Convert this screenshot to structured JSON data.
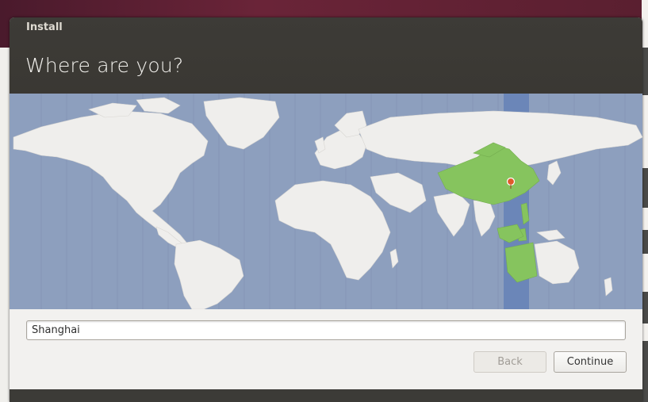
{
  "window": {
    "title": "Install",
    "heading": "Where are you?"
  },
  "location": {
    "value": "Shanghai",
    "selected_country": "China"
  },
  "buttons": {
    "back_label": "Back",
    "continue_label": "Continue"
  },
  "colors": {
    "header_bg": "#3c3b37",
    "ocean": "#8d9fbe",
    "land": "#efeeec",
    "highlight_land": "#86c45e",
    "timezone_band": "#6b86b8",
    "pin": "#e05a2a"
  },
  "icons": {
    "map_pin": "location-pin-icon"
  }
}
